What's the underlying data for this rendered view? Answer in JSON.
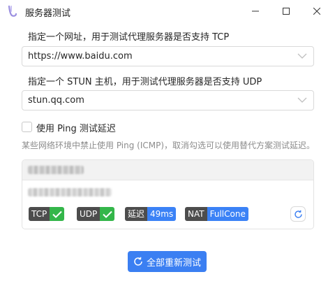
{
  "window": {
    "title": "服务器测试",
    "icon": "app-logo-icon",
    "controls": [
      "minimize-icon",
      "maximize-icon",
      "close-icon"
    ]
  },
  "tcp_test": {
    "label": "指定一个网址，用于测试代理服务器是否支持 TCP",
    "value": "https://www.baidu.com"
  },
  "udp_test": {
    "label": "指定一个 STUN 主机，用于测试代理服务器是否支持 UDP",
    "value": "stun.qq.com"
  },
  "ping_option": {
    "label": "使用 Ping 测试延迟",
    "checked": false,
    "hint": "某些网络环境中禁止使用 Ping (ICMP)，取消勾选可以使用替代方案测试延迟。"
  },
  "result_card": {
    "badges": {
      "tcp": {
        "key": "TCP",
        "status": "ok"
      },
      "udp": {
        "key": "UDP",
        "status": "ok"
      },
      "latency": {
        "key": "延迟",
        "value": "49ms"
      },
      "nat": {
        "key": "NAT",
        "value": "FullCone"
      }
    }
  },
  "actions": {
    "retest_all": "全部重新测试"
  },
  "colors": {
    "accent": "#3b7ff2",
    "success": "#34b64a",
    "badge_key": "#4d4d4d",
    "badge_value_blue": "#3b82f6"
  }
}
